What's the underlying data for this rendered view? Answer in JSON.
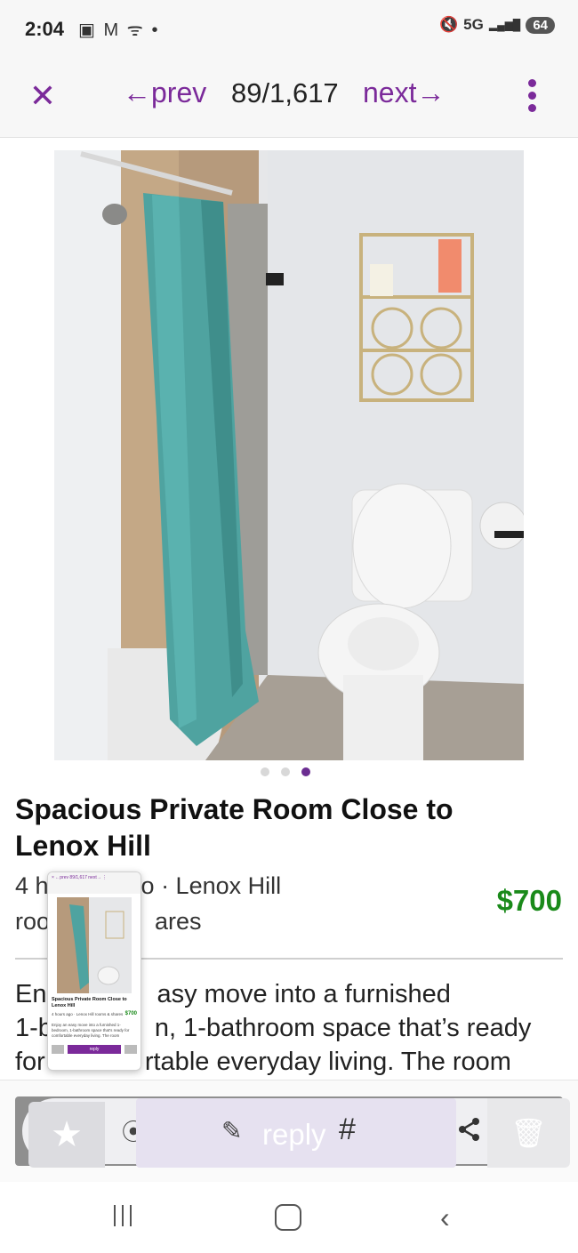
{
  "status": {
    "time": "2:04",
    "left_icons": "▣ M ᯤ •",
    "network": "5G",
    "signal": "▂▄▆█",
    "battery": "64"
  },
  "toolbar": {
    "close_icon": "close-icon",
    "prev_label": "←prev",
    "counter": "89/1,617",
    "next_label": "next→",
    "menu_icon": "more-vert-icon"
  },
  "listing": {
    "title": "Spacious Private Room Close to Lenox Hill",
    "meta_line1": "4 hours ago · Lenox Hill",
    "meta_line2": "rooms & shares",
    "price": "$700",
    "description": "Enjoy an easy move into a furnished 1-bedroom, 1-bathroom space that’s ready for comfortable everyday living. The room",
    "gallery_total": 3,
    "gallery_active": 3
  },
  "overlay_visible": {
    "meta_line1_left": "4 h",
    "meta_line1_right": "o · Lenox Hill",
    "meta_line2_left": "roo",
    "meta_line2_right": "ares",
    "desc_line1_left": "En",
    "desc_line1_right": "asy move into a furnished",
    "desc_line2_left": "1-b",
    "desc_line2_right": "n, 1-bathroom space that’s ready",
    "desc_line3_left": "for",
    "desc_line3_right": "rtable everyday living. The room"
  },
  "thumbnail": {
    "bar_text": "×   ←prev 89/1,617 next→   ⋮",
    "title": "Spacious Private Room Close to Lenox Hill",
    "price": "$700",
    "meta": "4 hours ago · Lenox Hill rooms & shares",
    "desc": "Enjoy an easy move into a furnished 1-bedroom, 1-bathroom space that's ready for comfortable everyday living. The room",
    "reply": "reply"
  },
  "actions": {
    "favorite_icon": "star-icon",
    "scan_icon": "scan-icon",
    "reply_icon": "reply-edit-icon",
    "reply_label": "reply",
    "hash_label": "#",
    "share_icon": "share-icon",
    "delete_icon": "trash-icon"
  },
  "nav": {
    "recent_icon": "recent-apps-icon",
    "home_icon": "home-icon",
    "back_icon": "back-icon"
  },
  "colors": {
    "accent": "#7b2a9a",
    "price": "#1a8a1a",
    "curtain": "#4fa3a0"
  }
}
